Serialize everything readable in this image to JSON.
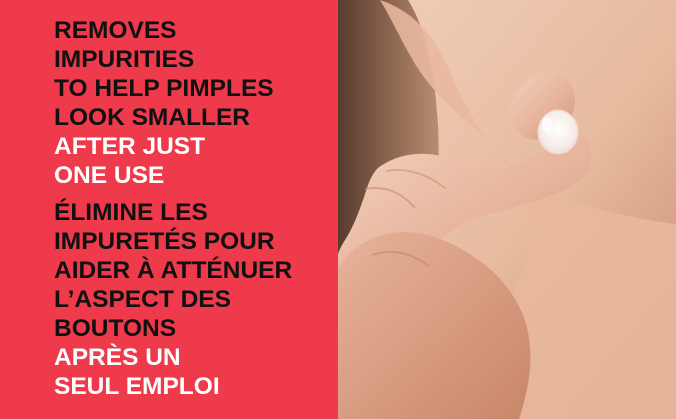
{
  "text": {
    "english": {
      "black_lines": [
        "REMOVES",
        "IMPURITIES",
        "TO HELP PIMPLES",
        "LOOK SMALLER"
      ],
      "white_lines": [
        "AFTER JUST",
        "ONE USE"
      ]
    },
    "french": {
      "black_lines": [
        "ÉLIMINE LES",
        "IMPURETÉS POUR",
        "AIDER À ATTÉNUER",
        "L’ASPECT DES",
        "BOUTONS"
      ],
      "white_lines": [
        "APRÈS UN",
        "SEUL EMPLOI"
      ]
    }
  },
  "colors": {
    "panel_background": "#ee3a4b",
    "text_dark": "#111111",
    "text_light": "#ffffff",
    "skin_light": "#f3d3bf",
    "skin_mid": "#e2b59a",
    "hair_tone": "#6f4d37",
    "patch_tone": "#f8eeea"
  },
  "image": {
    "subject": "close-up of neck and fingers applying a small patch"
  }
}
